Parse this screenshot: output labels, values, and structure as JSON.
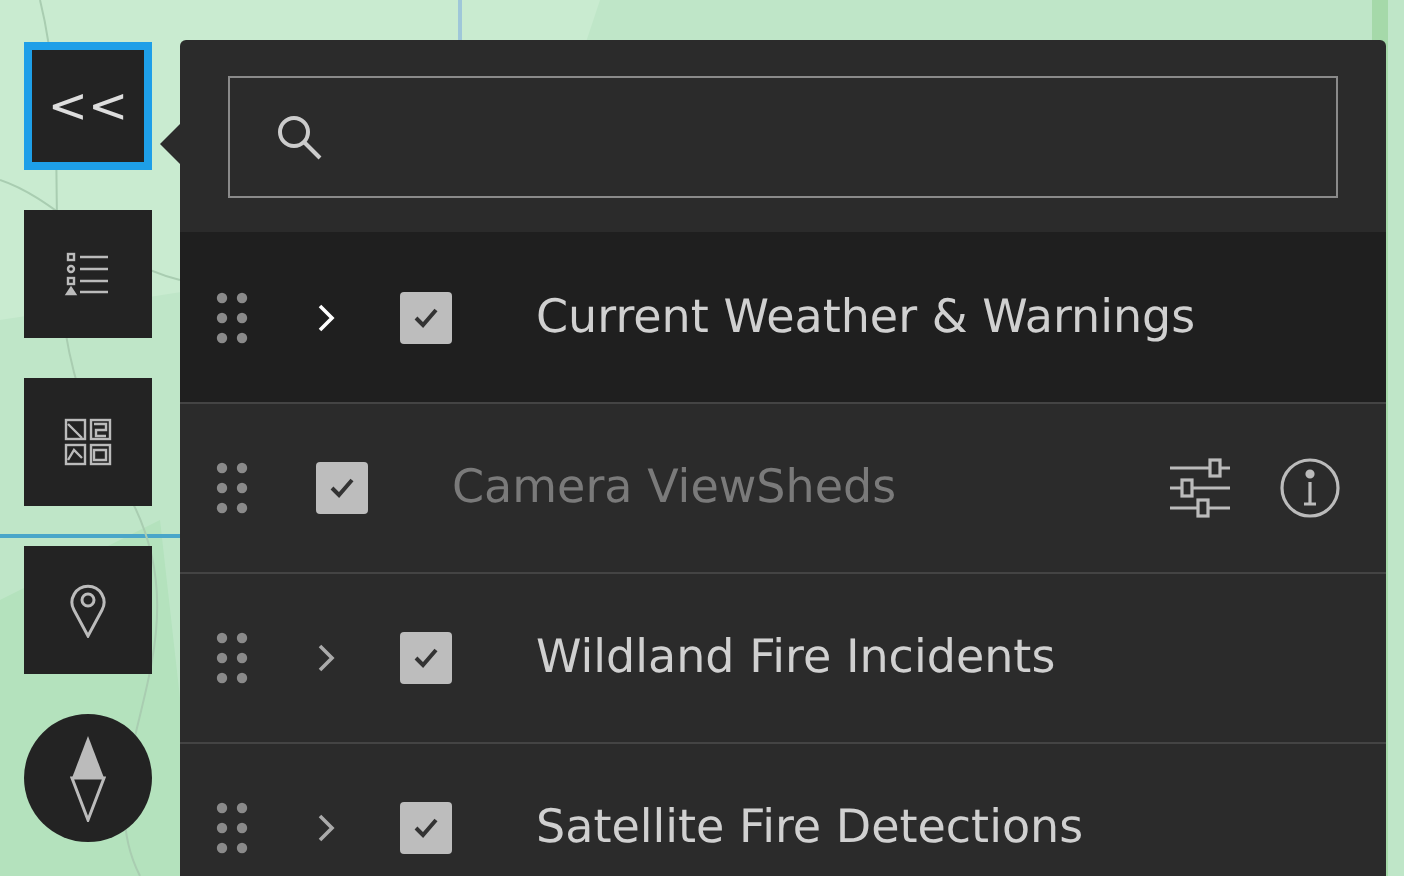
{
  "toolbar": [
    {
      "kind": "collapse",
      "label": "<<",
      "selected": true
    },
    {
      "kind": "legend",
      "selected": false
    },
    {
      "kind": "basemap",
      "selected": false
    },
    {
      "kind": "locate",
      "selected": false
    },
    {
      "kind": "compass",
      "selected": false
    }
  ],
  "layer_list": {
    "layers": [
      {
        "kind": "group",
        "title": "Current Weather & Warnings",
        "checked": true,
        "selected": true,
        "dimmed": false
      },
      {
        "kind": "layer",
        "title": "Camera ViewSheds",
        "checked": true,
        "selected": false,
        "dimmed": true
      },
      {
        "kind": "group",
        "title": "Wildland Fire Incidents",
        "checked": true,
        "selected": false,
        "dimmed": false
      },
      {
        "kind": "group",
        "title": "Satellite Fire Detections",
        "checked": true,
        "selected": false,
        "dimmed": false
      }
    ]
  }
}
